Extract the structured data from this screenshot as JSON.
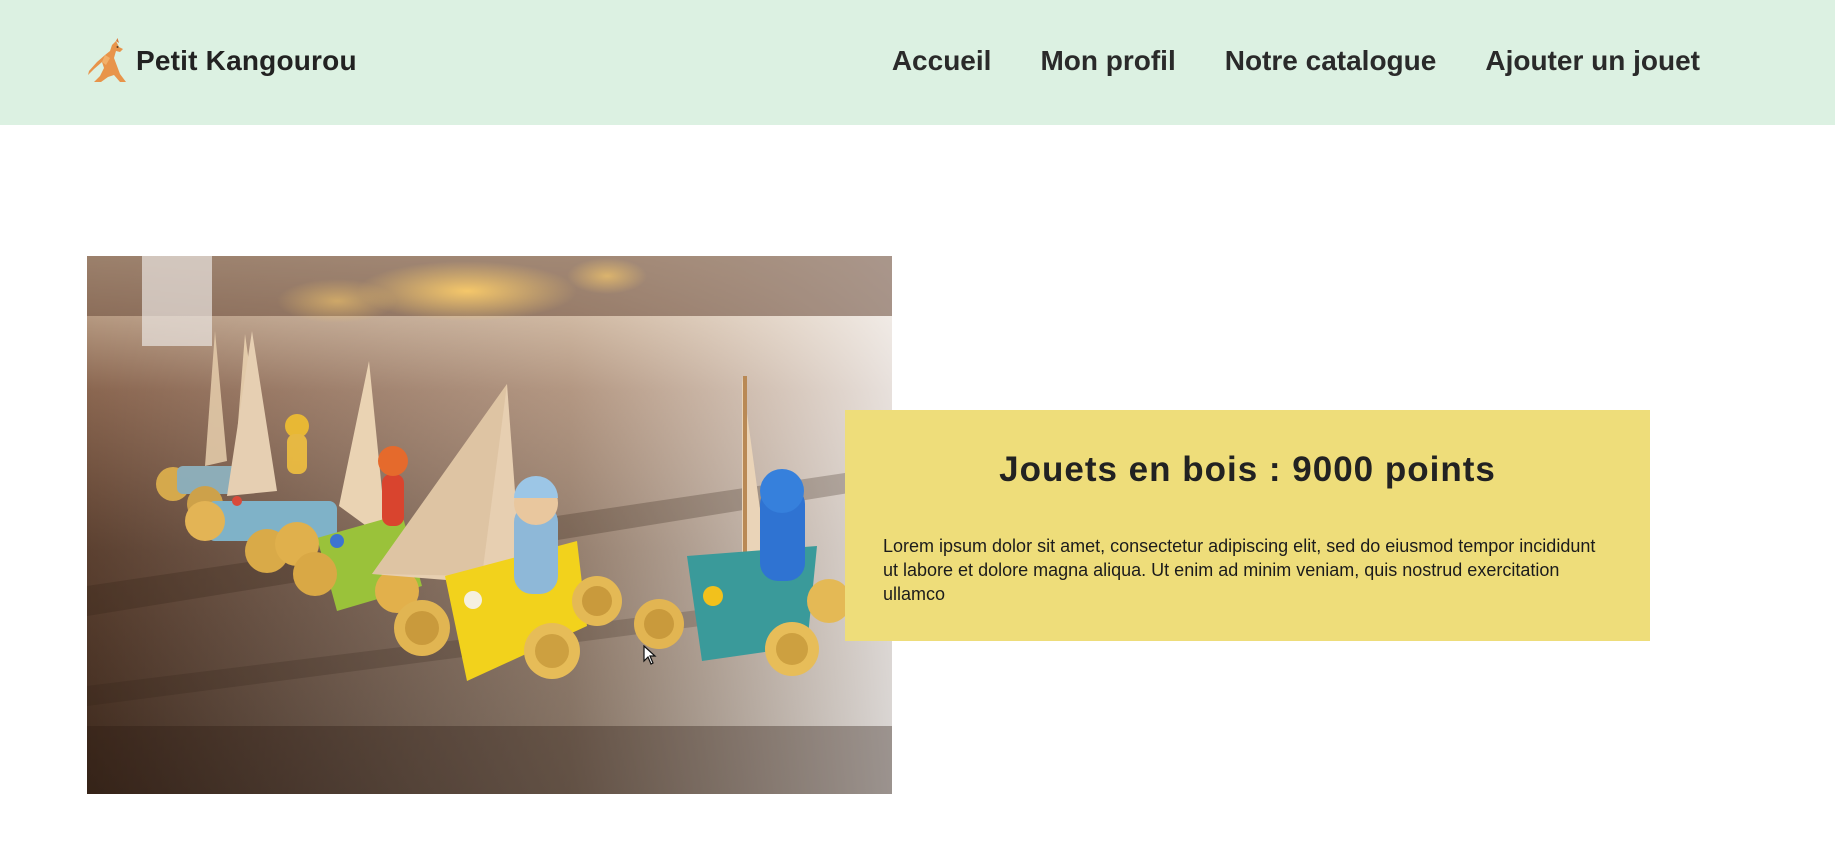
{
  "navbar": {
    "brand_name": "Petit Kangourou",
    "brand_icon": "kangaroo-icon",
    "links": [
      {
        "label": "Accueil"
      },
      {
        "label": "Mon profil"
      },
      {
        "label": "Notre catalogue"
      },
      {
        "label": "Ajouter un jouet"
      }
    ]
  },
  "hero": {
    "image": "wooden-toy-sailboats-photo"
  },
  "card": {
    "title": "Jouets en bois : 9000 points",
    "text": "Lorem ipsum dolor sit amet, consectetur adipiscing elit, sed do eiusmod tempor incididunt ut labore et dolore magna aliqua. Ut enim ad minim veniam, quis nostrud exercitation ullamco"
  },
  "colors": {
    "navbar_bg": "#dcf1e2",
    "card_bg": "#eedd7a",
    "text": "#222222"
  }
}
